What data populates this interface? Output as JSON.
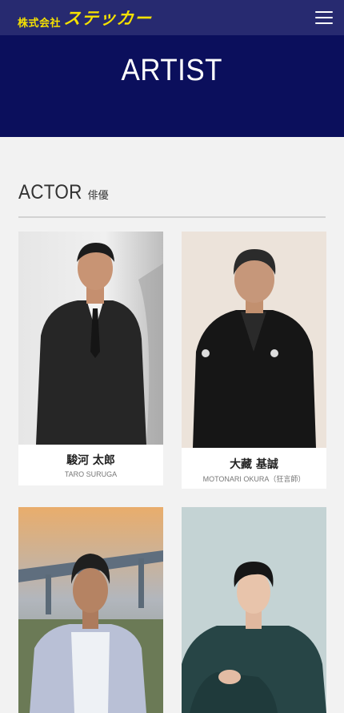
{
  "header": {
    "logo_small": "株式会社",
    "logo_big": "ステッカー",
    "menu_icon": "hamburger-menu-icon",
    "colors": {
      "bar": "#272a70",
      "logo": "#f5e100"
    }
  },
  "hero": {
    "title": "ARTIST",
    "color": "#0b0f5c"
  },
  "section": {
    "title": "ACTOR",
    "subtitle": "俳優"
  },
  "artists": [
    {
      "name": "駿河 太郎",
      "roman": "TARO SURUGA"
    },
    {
      "name": "大藏 基誠",
      "roman": "MOTONARI OKURA（狂言師）"
    },
    {
      "name": "",
      "roman": ""
    },
    {
      "name": "",
      "roman": ""
    }
  ]
}
